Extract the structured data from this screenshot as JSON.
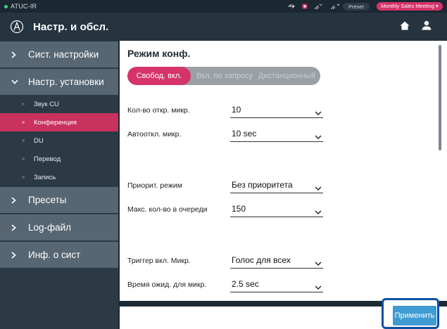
{
  "status": {
    "device_name": "ATUC-IR",
    "preset_label": "Preset",
    "meeting_label": "Monthly Sales Meeting",
    "colors": {
      "online": "#39d97a",
      "accent": "#d63369"
    }
  },
  "header": {
    "title": "Настр. и обсл."
  },
  "sidebar": {
    "items": [
      {
        "label": "Сист. настройки"
      },
      {
        "label": "Настр. установки"
      },
      {
        "label": "Пресеты"
      },
      {
        "label": "Log-файл"
      },
      {
        "label": "Инф. о сист"
      }
    ],
    "subitems": [
      {
        "label": "Звук CU"
      },
      {
        "label": "Конференция"
      },
      {
        "label": "DU"
      },
      {
        "label": "Перевод"
      },
      {
        "label": "Запись"
      }
    ]
  },
  "main": {
    "title": "Режим конф.",
    "modes": [
      "Свобод. вкл.",
      "Вкл. по запросу",
      "Дистанционный"
    ],
    "fields": [
      {
        "label": "Кол-во откр. микр.",
        "value": "10"
      },
      {
        "label": "Автооткл. микр.",
        "value": "10 sec"
      },
      {
        "label": "Приорит. режим",
        "value": "Без приоритета"
      },
      {
        "label": "Макс. кол-во в очереди",
        "value": "150"
      },
      {
        "label": "Триггер вкл. Микр.",
        "value": "Голос для всех"
      },
      {
        "label": "Время ожид. для микр.",
        "value": "2.5 sec"
      }
    ]
  },
  "footer": {
    "apply_label": "Применить"
  }
}
